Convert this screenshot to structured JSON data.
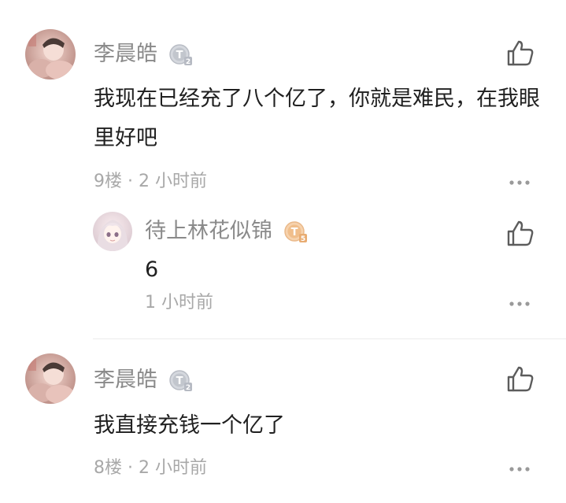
{
  "comments": [
    {
      "username": "李晨皓",
      "level_label": "T2",
      "content": "我现在已经充了八个亿了，你就是难民，在我眼里好吧",
      "floor": "9楼",
      "separator": "·",
      "time": "2 小时前",
      "avatar_icon": "user-avatar",
      "like_icon": "thumbs-up-icon",
      "more_icon": "more-dots-icon",
      "replies": [
        {
          "username": "待上林花似锦",
          "level_label": "T5",
          "content": "6",
          "time": "1 小时前",
          "avatar_icon": "anime-avatar"
        }
      ]
    },
    {
      "username": "李晨皓",
      "level_label": "T2",
      "content": "我直接充钱一个亿了",
      "floor": "8楼",
      "separator": "·",
      "time": "2 小时前",
      "avatar_icon": "user-avatar"
    }
  ],
  "colors": {
    "username": "#8a8a8a",
    "meta": "#a8a8a8",
    "content": "#202020",
    "badge_silver": "#c9ccd3",
    "badge_gold": "#f0c79d",
    "icon": "#5c5c5c"
  }
}
